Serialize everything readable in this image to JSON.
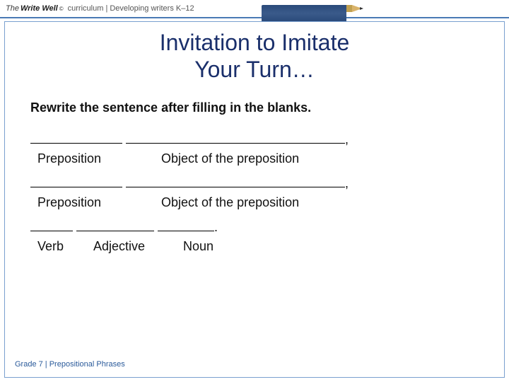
{
  "brand": {
    "the": "The",
    "name": "Write Well",
    "mark": "©",
    "rest": "curriculum | Developing writers K–12"
  },
  "title": {
    "line1": "Invitation to Imitate",
    "line2": "Your Turn…"
  },
  "instruction": "Rewrite the sentence after filling in the blanks.",
  "rows": {
    "r1": {
      "comma": ",",
      "lab1": "Preposition",
      "lab2": "Object of the preposition"
    },
    "r2": {
      "comma": ",",
      "lab1": "Preposition",
      "lab2": "Object of the preposition"
    },
    "r3": {
      "period": ".",
      "lab1": "Verb",
      "lab2": "Adjective",
      "lab3": "Noun"
    }
  },
  "footer": "Grade 7 | Prepositional Phrases"
}
